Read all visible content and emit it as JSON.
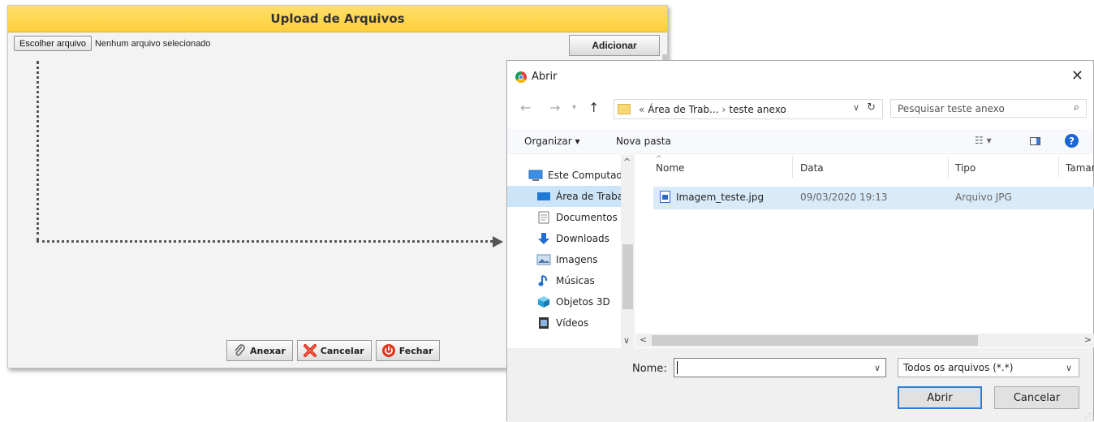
{
  "upload": {
    "title": "Upload de Arquivos",
    "choose_label": "Escolher arquivo",
    "no_file_label": "Nenhum arquivo selecionado",
    "add_label": "Adicionar",
    "attach_label": "Anexar",
    "cancel_label": "Cancelar",
    "close_label": "Fechar"
  },
  "dialog": {
    "title": "Abrir",
    "close_glyph": "✕",
    "address": {
      "prefix": "«",
      "segment1": "Área de Trab...",
      "separator": "›",
      "segment2": "teste anexo"
    },
    "search_placeholder": "Pesquisar teste anexo",
    "toolbar": {
      "organize": "Organizar ▾",
      "new_folder": "Nova pasta"
    },
    "nav_items": [
      {
        "label": "Este Computador",
        "icon": "computer-icon"
      },
      {
        "label": "Área de Trabalho",
        "icon": "desktop-icon"
      },
      {
        "label": "Documentos",
        "icon": "document-icon"
      },
      {
        "label": "Downloads",
        "icon": "download-icon"
      },
      {
        "label": "Imagens",
        "icon": "image-icon"
      },
      {
        "label": "Músicas",
        "icon": "music-icon"
      },
      {
        "label": "Objetos 3D",
        "icon": "cube-icon"
      },
      {
        "label": "Vídeos",
        "icon": "video-icon"
      }
    ],
    "columns": [
      "Nome",
      "Data",
      "Tipo",
      "Tamanho"
    ],
    "files": [
      {
        "name": "Imagem_teste.jpg",
        "date": "09/03/2020 19:13",
        "type": "Arquivo JPG"
      }
    ],
    "name_label": "Nome:",
    "name_value": "",
    "file_type": "Todos os arquivos (*.*)",
    "open_label": "Abrir",
    "cancel_label": "Cancelar"
  },
  "colors": {
    "header_yellow": "#ffd54a",
    "selection_blue": "#cce4f7",
    "accent_blue": "#2d7fd6"
  }
}
